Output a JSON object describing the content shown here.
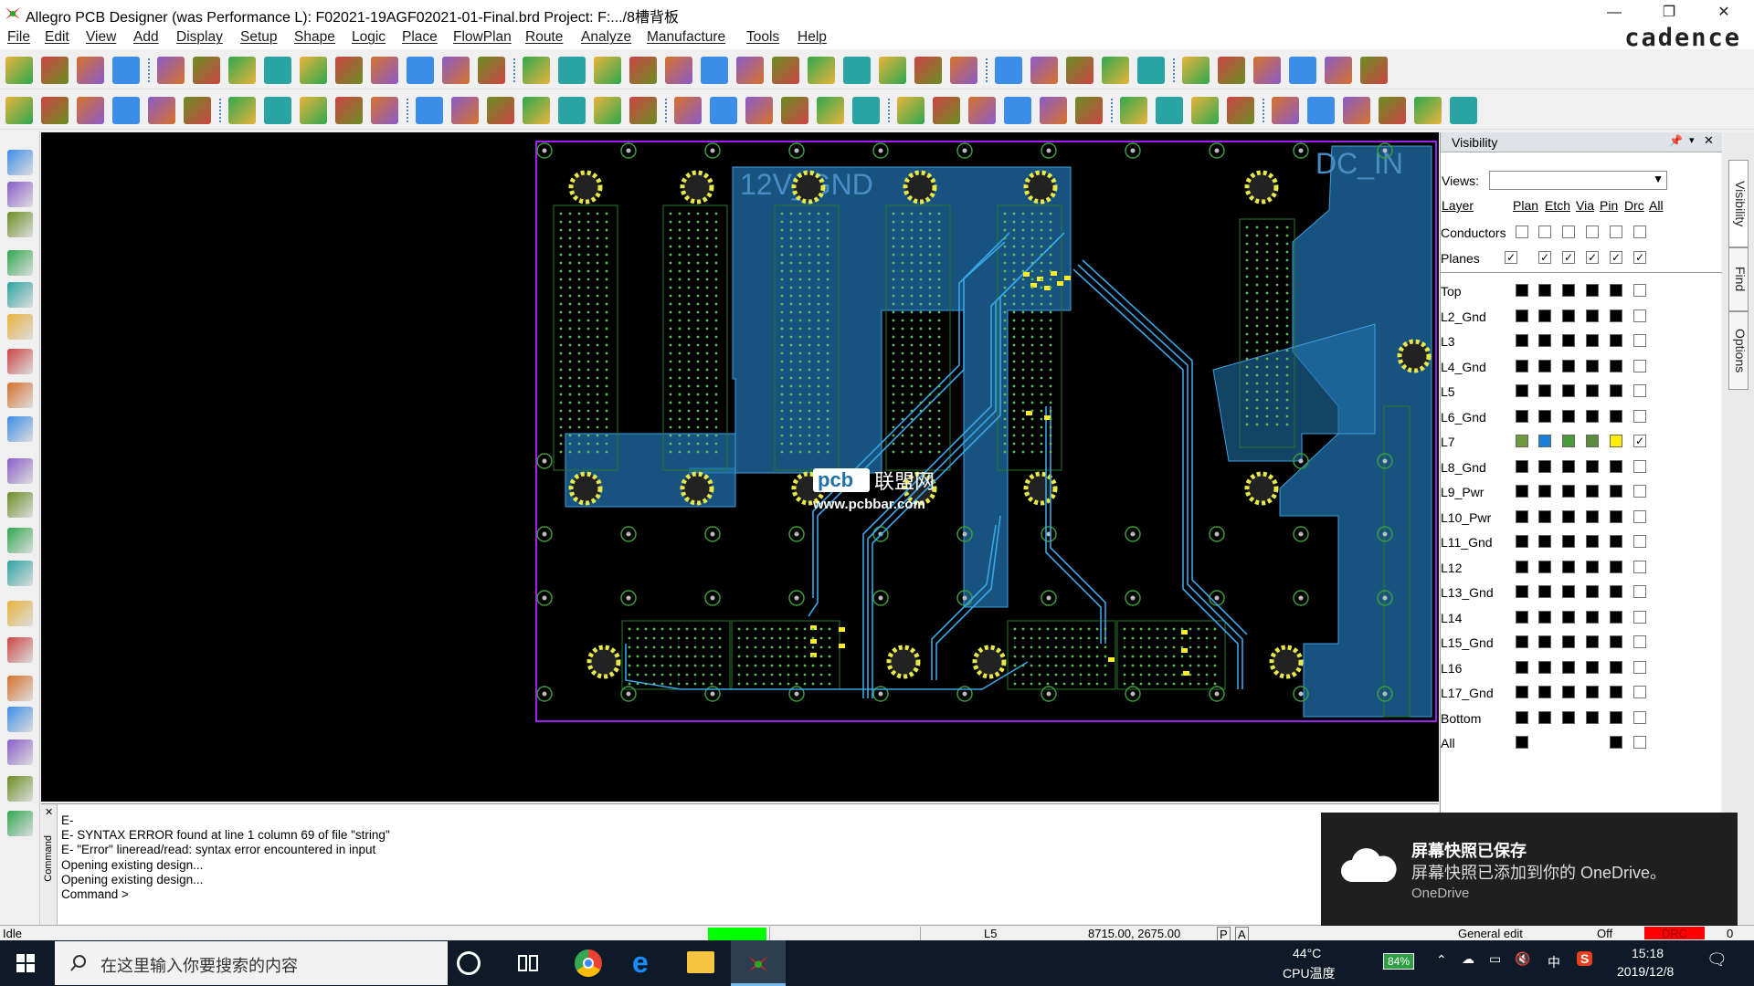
{
  "window": {
    "title": "Allegro PCB Designer (was Performance L): F02021-19AGF02021-01-Final.brd  Project: F:.../8槽背板",
    "brand": "cadence",
    "min": "—",
    "max": "❐",
    "close": "✕"
  },
  "menu": [
    "File",
    "Edit",
    "View",
    "Add",
    "Display",
    "Setup",
    "Shape",
    "Logic",
    "Place",
    "FlowPlan",
    "Route",
    "Analyze",
    "Manufacture",
    "Tools",
    "Help"
  ],
  "board": {
    "plane_label1": "12V_GND",
    "plane_label2": "DC_IN",
    "watermark_brand": "pcb",
    "watermark_cn": "联盟网",
    "watermark_url": "www.pcbbar.com"
  },
  "visibility": {
    "title": "Visibility",
    "views_label": "Views:",
    "views_value": "",
    "headers": {
      "layer": "Layer",
      "plan": "Plan",
      "etch": "Etch",
      "via": "Via",
      "pin": "Pin",
      "drc": "Drc",
      "all": "All"
    },
    "conductors_label": "Conductors",
    "planes_label": "Planes",
    "layers": [
      "Top",
      "L2_Gnd",
      "L3",
      "L4_Gnd",
      "L5",
      "L6_Gnd",
      "L7",
      "L8_Gnd",
      "L9_Pwr",
      "L10_Pwr",
      "L11_Gnd",
      "L12",
      "L13_Gnd",
      "L14",
      "L15_Gnd",
      "L16",
      "L17_Gnd",
      "Bottom",
      "All"
    ],
    "tabs": [
      "Visibility",
      "Find",
      "Options"
    ]
  },
  "command": {
    "side_label": "Command",
    "lines": [
      "E-",
      "E- SYNTAX ERROR found at line 1 column 69 of file \"string\"",
      "E- \"Error\" lineread/read: syntax error encountered in input",
      "Opening existing design...",
      "Opening existing design...",
      "Command >"
    ]
  },
  "status": {
    "state": "Idle",
    "layer": "L5",
    "coords": "8715.00, 2675.00",
    "p": "P",
    "a": "A",
    "mode": "General edit",
    "off": "Off",
    "drc": "DRC",
    "zero": "0",
    "green": "#00ff00",
    "red": "#ff0000"
  },
  "toast": {
    "title": "屏幕快照已保存",
    "body": "屏幕快照已添加到你的 OneDrive。",
    "app": "OneDrive"
  },
  "taskbar": {
    "search_placeholder": "在这里输入你要搜索的内容",
    "temp": "44°C",
    "temp_label": "CPU温度",
    "battery": "84%",
    "ime": "中",
    "time": "15:18",
    "date": "2019/12/8"
  }
}
